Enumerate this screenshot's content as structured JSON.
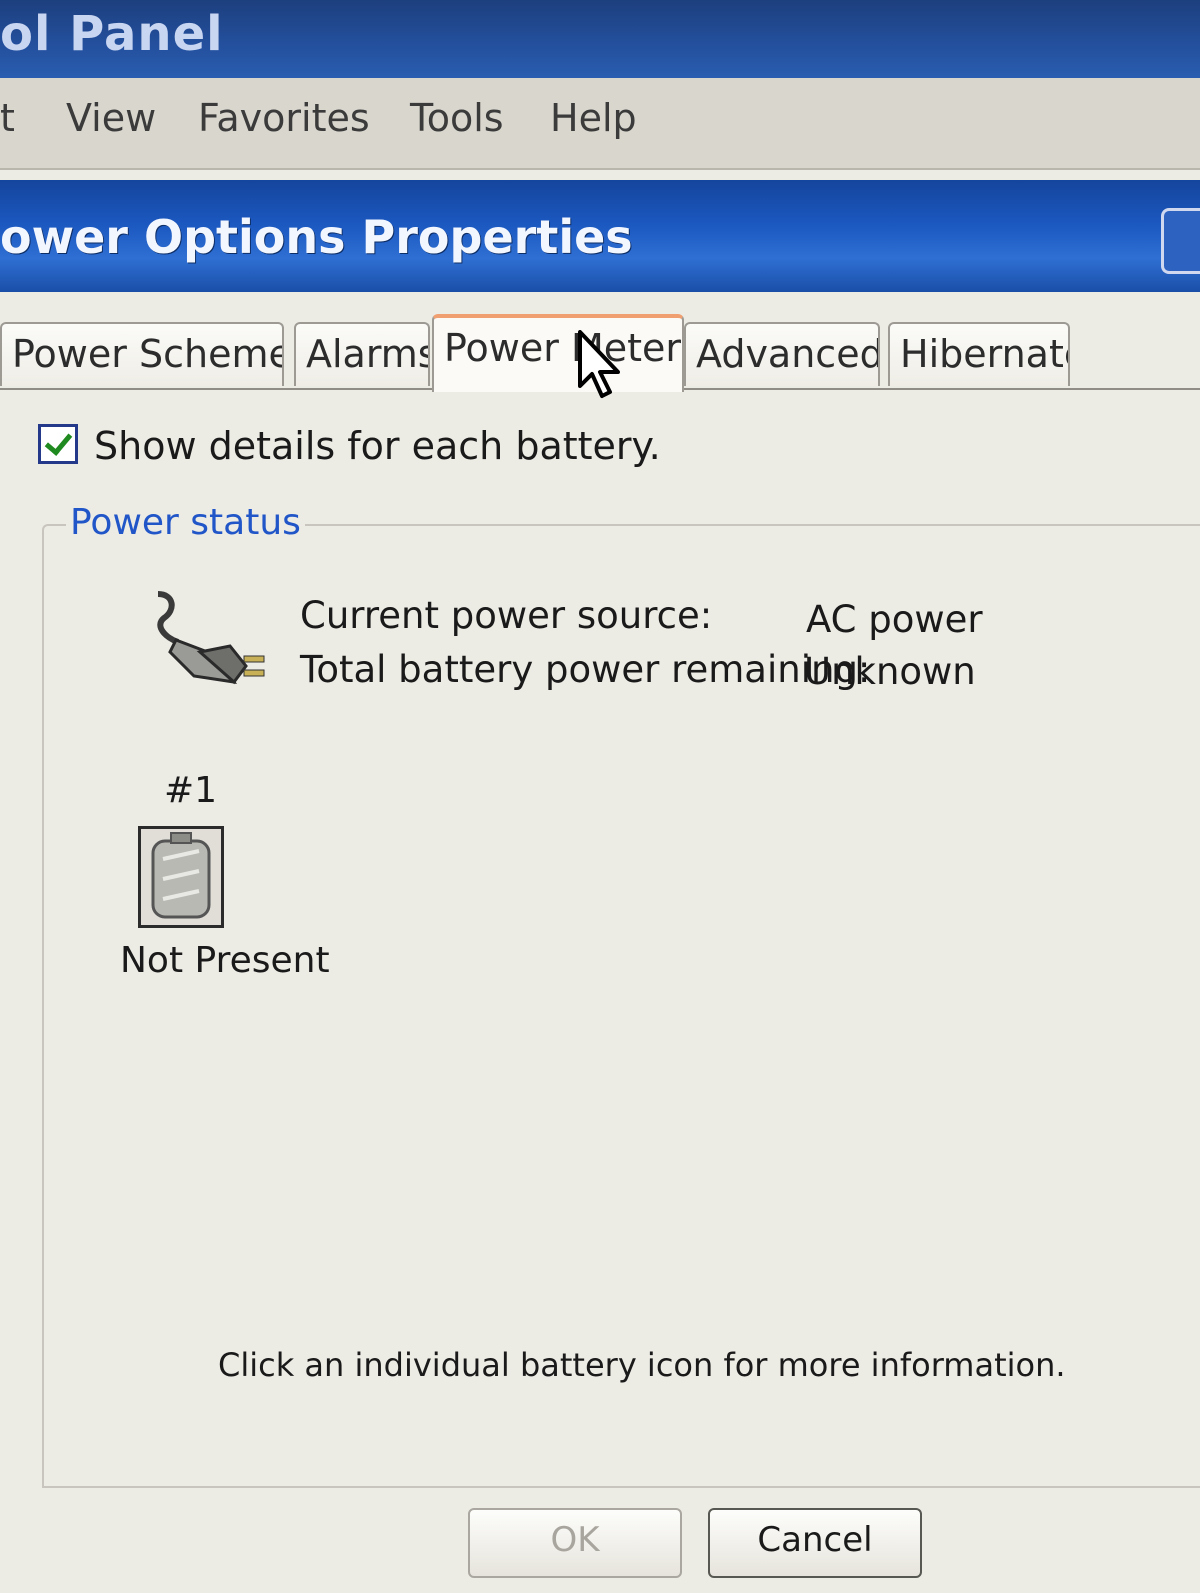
{
  "parent_window": {
    "title": "ol Panel",
    "menu": [
      "t",
      "View",
      "Favorites",
      "Tools",
      "Help"
    ]
  },
  "dialog": {
    "title": "ower Options Properties",
    "tabs": [
      "Power Schemes",
      "Alarms",
      "Power Meter",
      "Advanced",
      "Hibernate"
    ],
    "active_tab": "Power Meter",
    "show_details": {
      "label": "Show details for each battery.",
      "checked": true
    },
    "power_status": {
      "group_label": "Power status",
      "source_label": "Current power source:",
      "source_value": "AC power",
      "remaining_label": "Total battery power remaining:",
      "remaining_value": "Unknown"
    },
    "batteries": [
      {
        "number": "#1",
        "status": "Not Present"
      }
    ],
    "hint": "Click an individual battery icon for more information.",
    "buttons": {
      "ok": "OK",
      "cancel": "Cancel"
    }
  },
  "icons": [
    "plug-icon",
    "battery-icon",
    "checkmark-icon",
    "mouse-pointer-icon"
  ]
}
